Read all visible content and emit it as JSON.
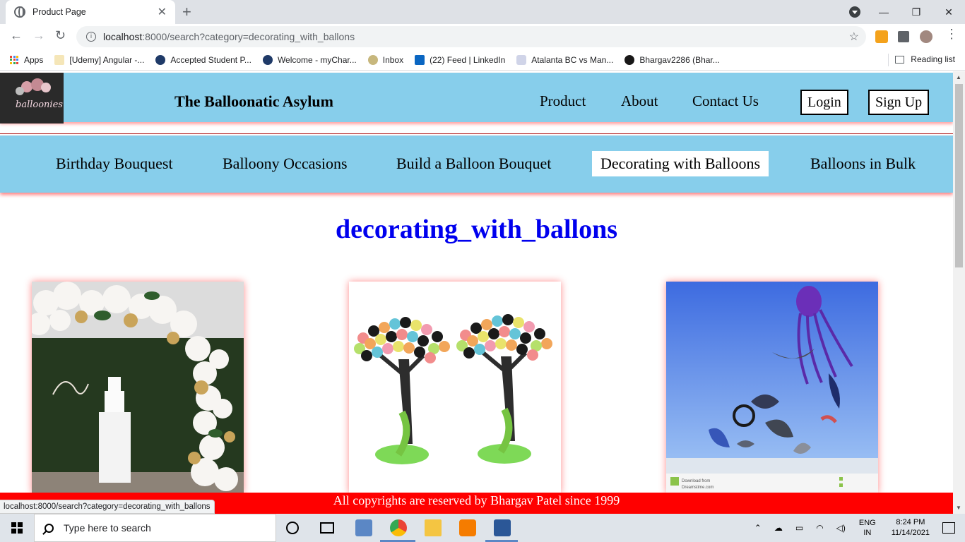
{
  "browser": {
    "tab_title": "Product Page",
    "url_host": "localhost",
    "url_rest": ":8000/search?category=decorating_with_ballons",
    "bookmarks": [
      "Apps",
      "[Udemy] Angular -...",
      "Accepted Student P...",
      "Welcome - myChar...",
      "Inbox",
      "(22) Feed | LinkedIn",
      "Atalanta BC vs Man...",
      "Bhargav2286 (Bhar..."
    ],
    "reading_list": "Reading list",
    "status_url": "localhost:8000/search?category=decorating_with_ballons"
  },
  "site": {
    "logo_text": "balloonies",
    "title": "The Balloonatic Asylum",
    "nav": [
      "Product",
      "About",
      "Contact Us"
    ],
    "login": "Login",
    "signup": "Sign Up",
    "categories": [
      "Birthday Bouquest",
      "Balloony Occasions",
      "Build a Balloon Bouquet",
      "Decorating with Balloons",
      "Balloons in Bulk"
    ],
    "active_category_index": 3,
    "heading": "decorating_with_ballons",
    "products": [
      {
        "image": "balloon-arch-cake-photo"
      },
      {
        "image": "balloon-trees-photo"
      },
      {
        "image": "kites-on-beach-photo",
        "watermark_lines": [
          "Download from",
          "Dreamstime.com"
        ]
      }
    ],
    "copyright": "All copyrights are reserved by Bhargav Patel since 1999",
    "colors": {
      "header": "#87ceeb",
      "heading": "#0000ee",
      "footer": "#ff0000"
    }
  },
  "taskbar": {
    "search_placeholder": "Type here to search",
    "lang_top": "ENG",
    "lang_bottom": "IN",
    "time": "8:24 PM",
    "date": "11/14/2021"
  }
}
